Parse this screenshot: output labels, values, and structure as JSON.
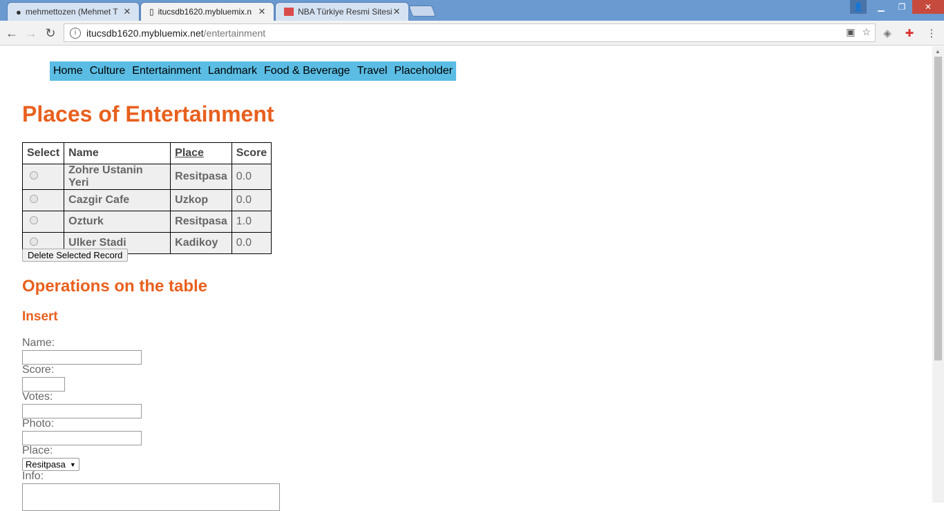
{
  "browser": {
    "tabs": [
      {
        "title": "mehmettozen (Mehmet T",
        "icon": "github-icon"
      },
      {
        "title": "itucsdb1620.mybluemix.n",
        "icon": "page-icon"
      },
      {
        "title": "NBA Türkiye Resmi Sitesi",
        "icon": "nba-icon"
      }
    ],
    "close_glyph": "✕",
    "url_host": "itucsdb1620.mybluemix.net",
    "url_path": "/entertainment"
  },
  "nav": {
    "items": [
      "Home",
      "Culture",
      "Entertainment",
      "Landmark",
      "Food & Beverage",
      "Travel",
      "Placeholder"
    ]
  },
  "page_title": "Places of Entertainment",
  "table": {
    "headers": {
      "select": "Select",
      "name": "Name",
      "place": "Place",
      "score": "Score"
    },
    "rows": [
      {
        "name": "Zohre Ustanin Yeri",
        "place": "Resitpasa",
        "score": "0.0"
      },
      {
        "name": "Cazgir Cafe",
        "place": "Uzkop",
        "score": "0.0"
      },
      {
        "name": "Ozturk",
        "place": "Resitpasa",
        "score": "1.0"
      },
      {
        "name": "Ulker Stadi",
        "place": "Kadikoy",
        "score": "0.0"
      }
    ]
  },
  "delete_button": "Delete Selected Record",
  "operations_heading": "Operations on the table",
  "insert_heading": "Insert",
  "form": {
    "name_label": "Name:",
    "score_label": "Score:",
    "votes_label": "Votes:",
    "photo_label": "Photo:",
    "place_label": "Place:",
    "place_selected": "Resitpasa",
    "info_label": "Info:"
  },
  "colors": {
    "accent": "#e8601e",
    "menu_bg": "#5bbde4",
    "titlebar": "#6a9ad0"
  }
}
